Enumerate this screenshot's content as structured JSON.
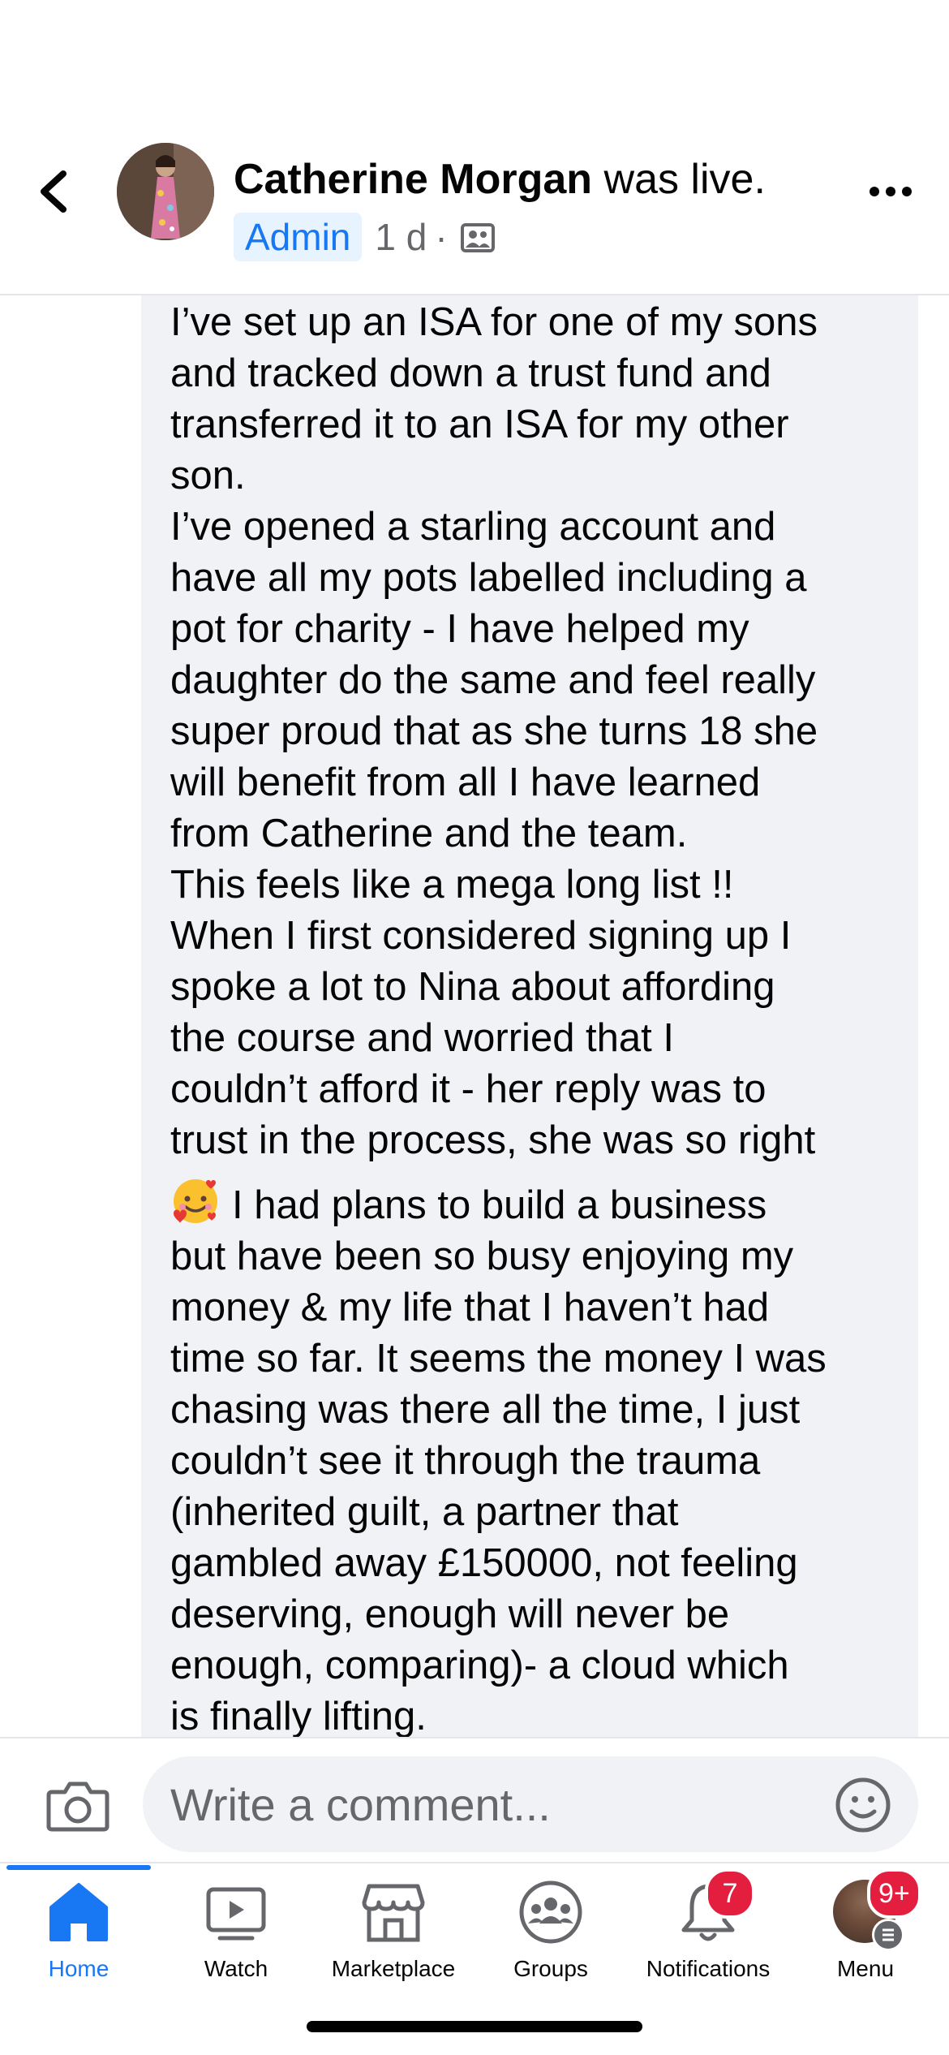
{
  "header": {
    "author_name": "Catherine Morgan",
    "author_action": "was live.",
    "admin_badge": "Admin",
    "timestamp": "1 d",
    "separator": "·",
    "privacy_icon": "group-privacy-icon",
    "back_icon": "chevron-left-icon",
    "more_icon": "more-dots-icon"
  },
  "comment": {
    "lines": [
      "I’ve set up an ISA for one of my sons",
      "and tracked down a trust fund and",
      "transferred it to an ISA for my other",
      "son.",
      "I’ve opened a starling account and",
      "have all my pots labelled including a",
      "pot for charity - I have helped my",
      "daughter do the same and feel really",
      "super proud that as she turns 18 she",
      "will benefit from all I have learned",
      "from Catherine and the team.",
      "This feels like a mega long list !!",
      "When I first considered signing up I",
      "spoke a lot to Nina about affording",
      "the course and worried that I",
      "couldn’t afford it - her reply was to",
      "trust in the process, she was so right",
      "I had plans to build a business",
      "but have been so busy enjoying my",
      "money & my life that I haven’t had",
      "time so far. It seems the money I was",
      "chasing was there all the time, I just",
      "couldn’t see it through the trauma",
      "(inherited guilt, a partner that",
      "gambled away £150000, not feeling",
      "deserving, enough will never be",
      "enough, comparing)- a cloud which",
      "is finally lifting."
    ],
    "emoji_icon": "smiling-face-with-hearts-icon"
  },
  "composer": {
    "placeholder": "Write a comment...",
    "camera_icon": "camera-icon",
    "emoji_icon": "smiley-icon"
  },
  "tabbar": {
    "tabs": [
      {
        "label": "Home",
        "icon": "home-icon",
        "active": true
      },
      {
        "label": "Watch",
        "icon": "video-play-icon"
      },
      {
        "label": "Marketplace",
        "icon": "marketplace-shop-icon"
      },
      {
        "label": "Groups",
        "icon": "groups-icon"
      },
      {
        "label": "Notifications",
        "icon": "bell-icon",
        "badge": "7"
      },
      {
        "label": "Menu",
        "icon": "profile-menu-icon",
        "badge": "9+"
      }
    ]
  },
  "colors": {
    "accent": "#1877f2",
    "badge_red": "#e41e3f",
    "bubble_bg": "#f0f2f5",
    "secondary_text": "#65676b"
  }
}
